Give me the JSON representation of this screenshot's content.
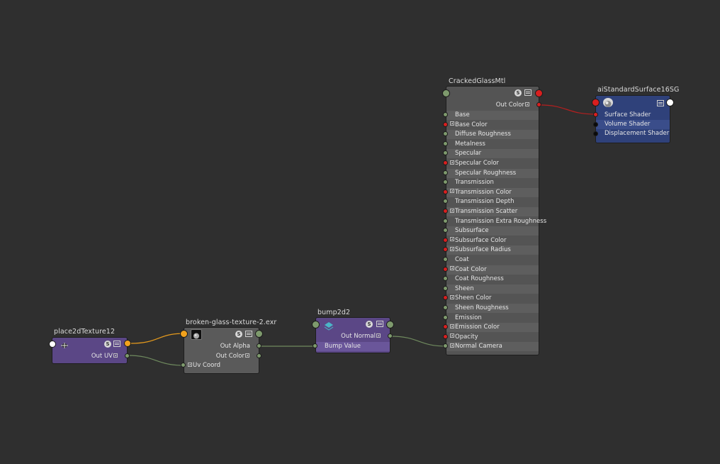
{
  "nodes": {
    "place2d": {
      "title": "place2dTexture12",
      "out_uv": "Out UV"
    },
    "file": {
      "title": "broken-glass-texture-2.exr",
      "out_alpha": "Out Alpha",
      "out_color": "Out Color",
      "uv_coord": "Uv Coord"
    },
    "bump": {
      "title": "bump2d2",
      "out_normal": "Out Normal",
      "bump_value": "Bump Value"
    },
    "material": {
      "title": "CrackedGlassMtl",
      "out_color": "Out Color",
      "attributes": [
        {
          "label": "Base",
          "port": "green",
          "expand": false
        },
        {
          "label": "Base Color",
          "port": "red",
          "expand": true
        },
        {
          "label": "Diffuse Roughness",
          "port": "green",
          "expand": false
        },
        {
          "label": "Metalness",
          "port": "green",
          "expand": false
        },
        {
          "label": "Specular",
          "port": "green",
          "expand": false
        },
        {
          "label": "Specular Color",
          "port": "red",
          "expand": true
        },
        {
          "label": "Specular Roughness",
          "port": "green",
          "expand": false
        },
        {
          "label": "Transmission",
          "port": "green",
          "expand": false
        },
        {
          "label": "Transmission Color",
          "port": "red",
          "expand": true
        },
        {
          "label": "Transmission Depth",
          "port": "green",
          "expand": false
        },
        {
          "label": "Transmission Scatter",
          "port": "red",
          "expand": true
        },
        {
          "label": "Transmission Extra Roughness",
          "port": "green",
          "expand": false
        },
        {
          "label": "Subsurface",
          "port": "green",
          "expand": false
        },
        {
          "label": "Subsurface Color",
          "port": "red",
          "expand": true
        },
        {
          "label": "Subsurface Radius",
          "port": "red",
          "expand": true
        },
        {
          "label": "Coat",
          "port": "green",
          "expand": false
        },
        {
          "label": "Coat Color",
          "port": "red",
          "expand": true
        },
        {
          "label": "Coat Roughness",
          "port": "green",
          "expand": false
        },
        {
          "label": "Sheen",
          "port": "green",
          "expand": false
        },
        {
          "label": "Sheen Color",
          "port": "red",
          "expand": true
        },
        {
          "label": "Sheen Roughness",
          "port": "green",
          "expand": false
        },
        {
          "label": "Emission",
          "port": "green",
          "expand": false
        },
        {
          "label": "Emission Color",
          "port": "red",
          "expand": true
        },
        {
          "label": "Opacity",
          "port": "red",
          "expand": true
        },
        {
          "label": "Normal Camera",
          "port": "green",
          "expand": true
        }
      ]
    },
    "sg": {
      "title": "aiStandardSurface16SG",
      "surface_shader": "Surface Shader",
      "volume_shader": "Volume Shader",
      "displacement_shader": "Displacement Shader"
    }
  },
  "sbutton": "S",
  "colors": {
    "background": "#2f2f2f",
    "utility_node": "#5b4786",
    "file_node": "#5a5a5a",
    "material_node": "#545454",
    "sg_node": "#2f417a",
    "port_green": "#7e9a6d",
    "port_red": "#d81f1f",
    "port_orange": "#f2a21d",
    "port_white": "#ffffff",
    "port_black": "#0a0a0a",
    "wire_green": "#6f8a5e",
    "wire_red": "#b51f1f",
    "wire_orange": "#e59a1d"
  }
}
